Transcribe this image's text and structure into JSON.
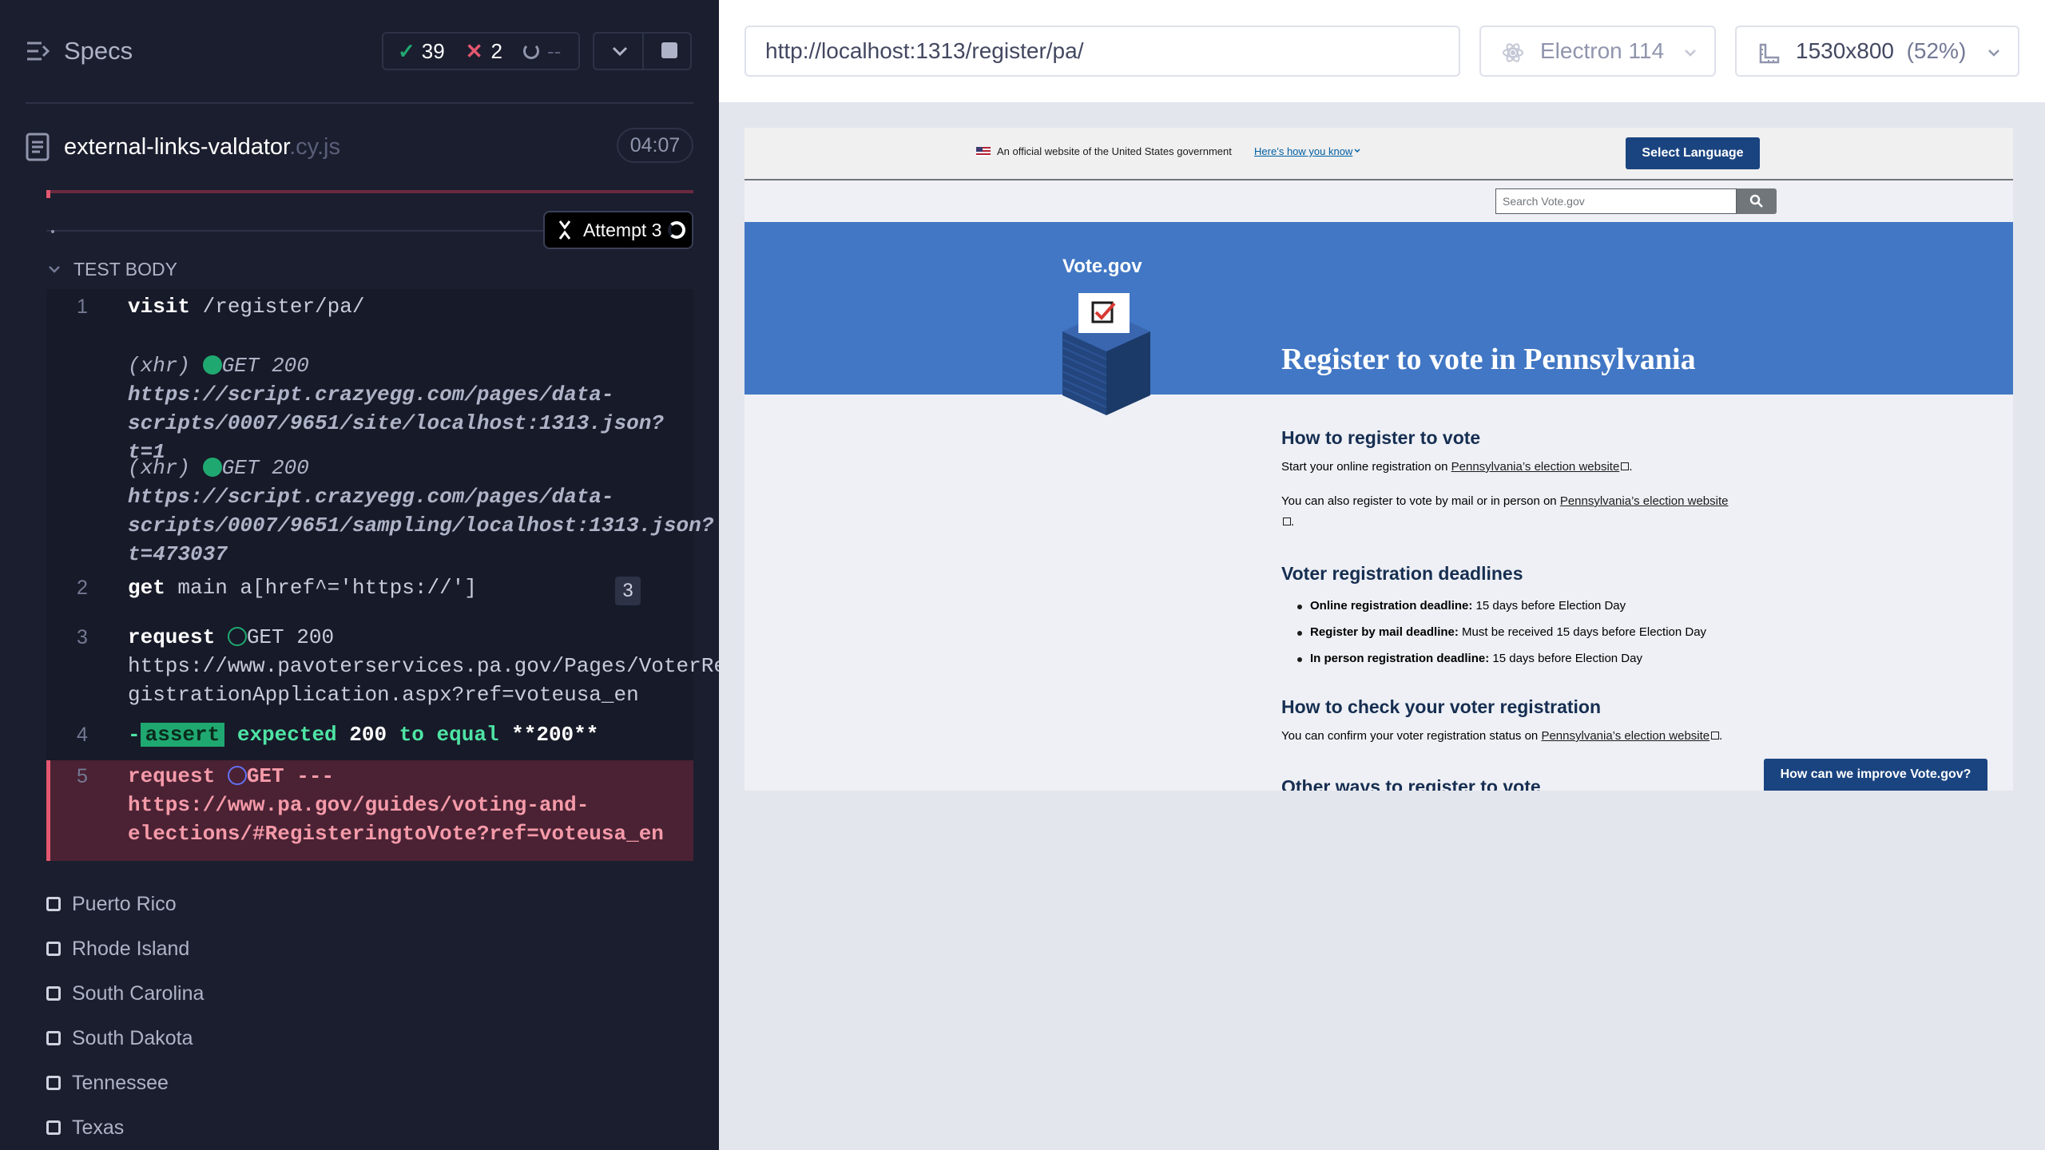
{
  "reporter": {
    "title": "Specs",
    "stats": {
      "passed": "39",
      "failed": "2",
      "pending": "--"
    },
    "spec": {
      "name": "external-links-valdator",
      "ext": ".cy.js",
      "duration": "04:07"
    },
    "attempt": "Attempt 3",
    "test_body_label": "TEST BODY",
    "commands": [
      {
        "num": "1",
        "name": "visit",
        "message": "/register/pa/"
      },
      {
        "label": "(xhr)",
        "status": "GET 200",
        "url_lines": [
          "https://script.crazyegg.com/pages/data-",
          "scripts/0007/9651/site/localhost:1313.json?t=1"
        ]
      },
      {
        "label": "(xhr)",
        "status": "GET 200",
        "url_lines": [
          "https://script.crazyegg.com/pages/data-",
          "scripts/0007/9651/sampling/localhost:1313.json?",
          "t=473037"
        ]
      },
      {
        "num": "2",
        "name": "get",
        "message": "main a[href^='https://']",
        "badge": "3"
      },
      {
        "num": "3",
        "name": "request",
        "status": "GET 200",
        "url_lines": [
          "https://www.pavoterservices.pa.gov/Pages/VoterRe",
          "gistrationApplication.aspx?ref=voteusa_en"
        ]
      },
      {
        "num": "4",
        "dash": "-",
        "name": "assert",
        "expected": "expected",
        "v1": "200",
        "to_equal": "to equal",
        "v2": "**200**"
      },
      {
        "num": "5",
        "name": "request",
        "status": "GET ---",
        "url_lines": [
          "https://www.pa.gov/guides/voting-and-",
          "elections/#RegisteringtoVote?ref=voteusa_en"
        ]
      }
    ],
    "states": [
      "Puerto Rico",
      "Rhode Island",
      "South Carolina",
      "South Dakota",
      "Tennessee",
      "Texas"
    ]
  },
  "browser_bar": {
    "url": "http://localhost:1313/register/pa/",
    "browser": "Electron 114",
    "viewport": "1530x800",
    "zoom": "(52%)"
  },
  "app": {
    "banner_text": "An official website of the United States government",
    "banner_link": "Here’s how you know",
    "language_button": "Select Language",
    "search_placeholder": "Search Vote.gov",
    "logo": "Vote.gov",
    "hero_title": "Register to vote in Pennsylvania",
    "h_register": "How to register to vote",
    "p1_pre": "Start your online registration on ",
    "p1_link": "Pennsylvania’s election website",
    "p1_post": ".",
    "p2_pre": "You can also register to vote by mail or in person on ",
    "p2_link": "Pennsylvania’s election website",
    "p2_post": ".",
    "h_deadlines": "Voter registration deadlines",
    "deadlines": [
      {
        "label": "Online registration deadline:",
        "text": " 15 days before Election Day"
      },
      {
        "label": "Register by mail deadline:",
        "text": " Must be received 15 days before Election Day"
      },
      {
        "label": "In person registration deadline:",
        "text": " 15 days before Election Day"
      }
    ],
    "h_check": "How to check your voter registration",
    "p3_pre": "You can confirm your voter registration status on ",
    "p3_link": "Pennsylvania’s election website",
    "p3_post": ".",
    "h_other": "Other ways to register to vote",
    "feedback_button": "How can we improve Vote.gov?"
  },
  "colors": {
    "pass": "#1fa971",
    "fail": "#e45770",
    "hero": "#4177c4",
    "navy": "#1a4480"
  }
}
